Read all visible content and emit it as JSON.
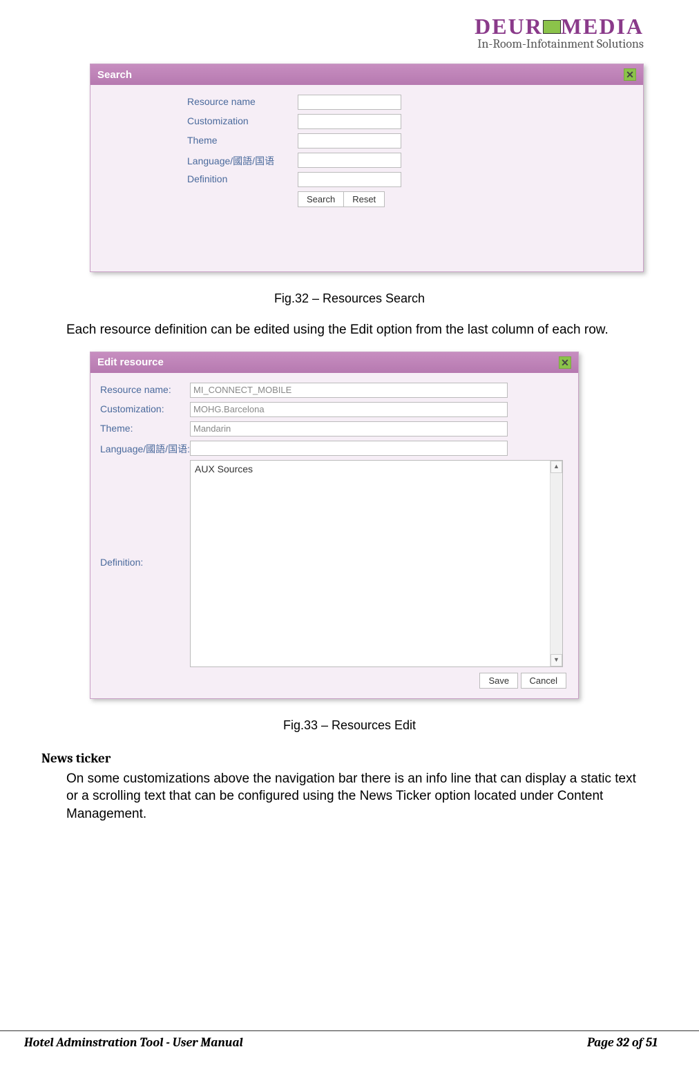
{
  "logo": {
    "brand": "DEUR",
    "brand2": "MEDIA",
    "tagline": "In-Room-Infotainment Solutions"
  },
  "search_panel": {
    "title": "Search",
    "fields": {
      "resource_name": "Resource name",
      "customization": "Customization",
      "theme": "Theme",
      "language": "Language/國語/国语",
      "definition": "Definition"
    },
    "buttons": {
      "search": "Search",
      "reset": "Reset"
    }
  },
  "caption1": "Fig.32 – Resources Search",
  "paragraph1": "Each resource definition can be edited using the Edit option from the last column of each row.",
  "edit_panel": {
    "title": "Edit resource",
    "fields": {
      "resource_name_label": "Resource name:",
      "resource_name_value": "MI_CONNECT_MOBILE",
      "customization_label": "Customization:",
      "customization_value": "MOHG.Barcelona",
      "theme_label": "Theme:",
      "theme_value": "Mandarin",
      "language_label": "Language/國語/国语:",
      "language_value": "",
      "definition_label": "Definition:",
      "definition_value": "AUX Sources"
    },
    "buttons": {
      "save": "Save",
      "cancel": "Cancel"
    }
  },
  "caption2": "Fig.33 – Resources Edit",
  "section_heading": "News ticker",
  "paragraph2": "On some customizations above the navigation bar there is an info line that can display a static text or a scrolling text that can be configured using the News Ticker option located under Content Management.",
  "footer": {
    "left": "Hotel Adminstration Tool - User Manual",
    "right": "Page 32 of 51"
  }
}
